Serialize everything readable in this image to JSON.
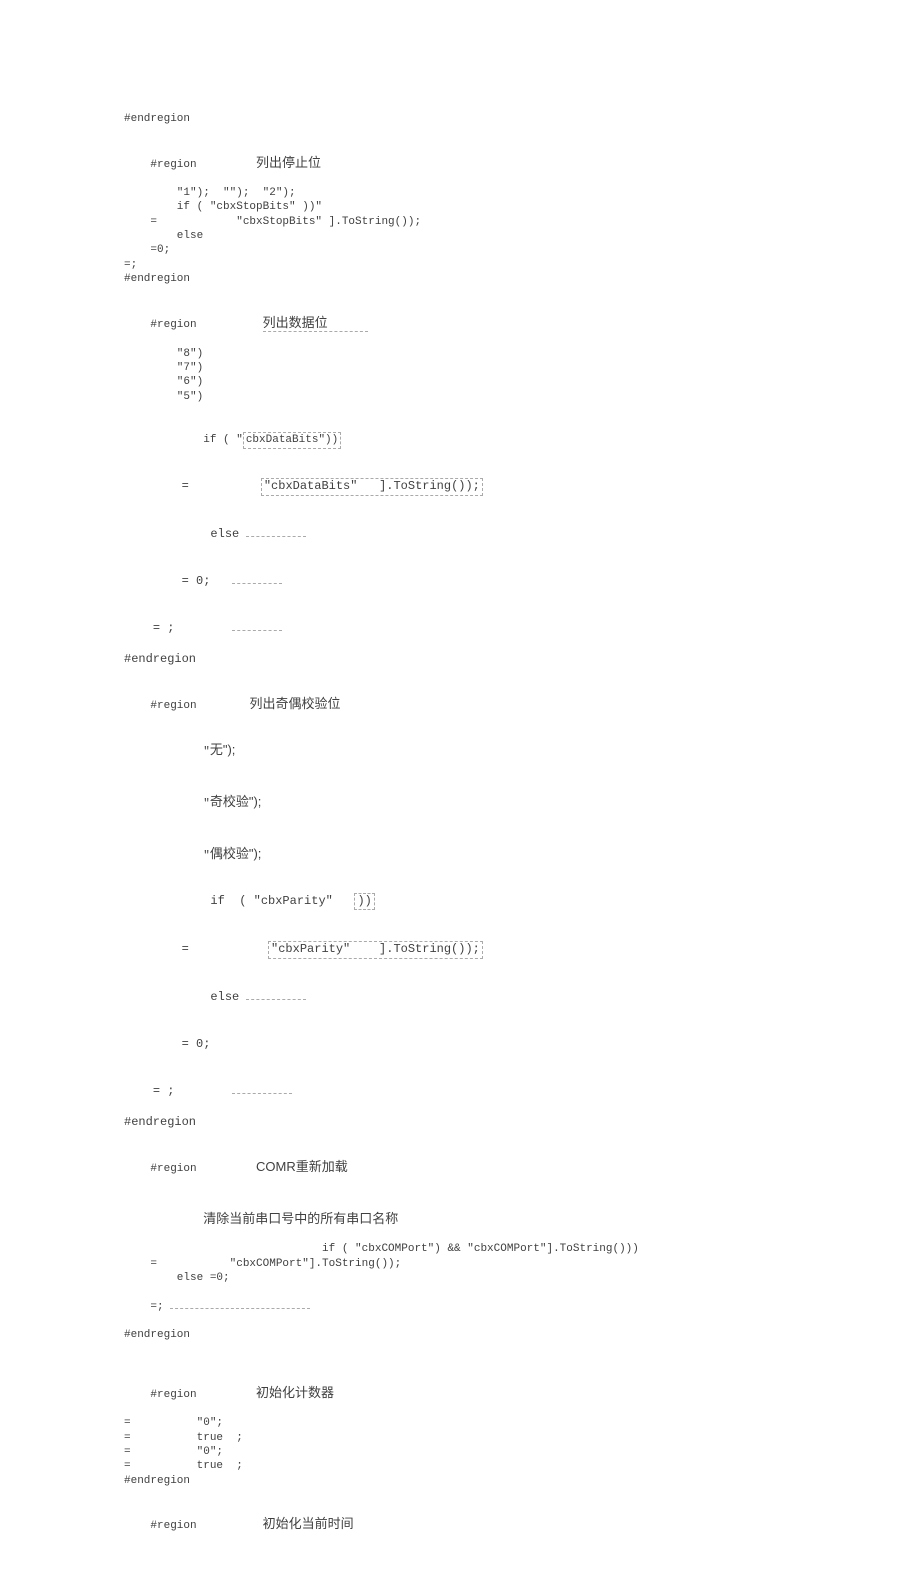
{
  "doc": {
    "r1_end": "#endregion",
    "r2_hdr_kw": "#region",
    "r2_hdr_cn": "列出停止位",
    "r2_l1": "        \"1\");  \"\");  \"2\");",
    "r2_l2": "        if ( \"cbxStopBits\" ))\"",
    "r2_l3a": "    =            \"cbxStopBits\" ].ToString());",
    "r2_l4": "        else",
    "r2_l5": "    =0;",
    "r2_l6": "=;",
    "r2_end": "#endregion",
    "r3_hdr_kw": "#region",
    "r3_hdr_cn": "列出数据位",
    "r3_l1": "        \"8\")",
    "r3_l2": "        \"7\")",
    "r3_l3": "        \"6\")",
    "r3_l4": "        \"5\")",
    "r3_l5": "        if ( \"cbxDataBits\"))",
    "r3_l6": "    =          \"cbxDataBits\"   ].ToString());",
    "r3_l7": "        else",
    "r3_l8": "    = 0;",
    "r3_l9": "= ;",
    "r3_end": "#endregion",
    "r4_hdr_kw": "#region",
    "r4_hdr_cn": "列出奇偶校验位",
    "r4_l1a": "        \"",
    "r4_l1b": "无\");",
    "r4_l2a": "        \"",
    "r4_l2b": "奇校验\");",
    "r4_l3a": "        \"",
    "r4_l3b": "偶校验\");",
    "r4_l4": "        if  ( \"cbxParity\"   ))",
    "r4_l5": "    =           \"cbxParity\"    ].ToString());",
    "r4_l6": "        else",
    "r4_l7": "    = 0;",
    "r4_l8": "= ;",
    "r4_end": "#endregion",
    "r5_hdr_kw": "#region",
    "r5_hdr_cn": "COMR重新加载",
    "r5_l1": "清除当前串口号中的所有串口名称",
    "r5_l2": "                              if ( \"cbxCOMPort\") && \"cbxCOMPort\"].ToString()))",
    "r5_l3": "    =           \"cbxCOMPort\"].ToString());",
    "r5_l4": "        else =0;",
    "r5_l5": "=;",
    "r5_end": "#endregion",
    "r6_hdr_kw": "#region",
    "r6_hdr_cn": "初始化计数器",
    "r6_l1": "=          \"0\";",
    "r6_l2": "=          true  ;",
    "r6_l3": "=          \"0\";",
    "r6_l4": "=          true  ;",
    "r6_end": "#endregion",
    "r7_hdr_kw": "#region",
    "r7_hdr_cn": "初始化当前时间"
  }
}
